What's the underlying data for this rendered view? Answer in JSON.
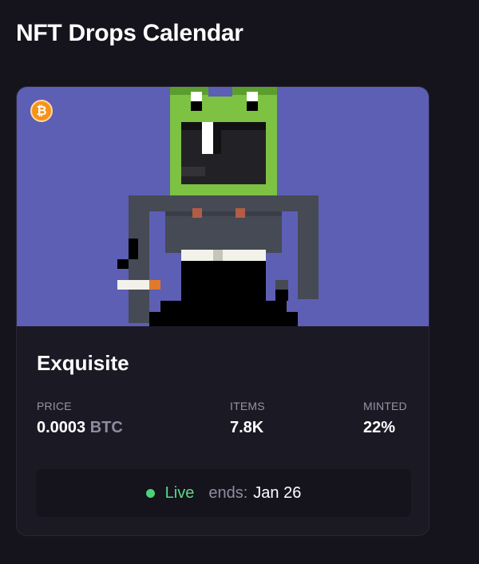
{
  "page": {
    "title": "NFT Drops Calendar"
  },
  "card": {
    "chain_icon": "bitcoin-icon",
    "chain_symbol": "₿",
    "art_background": "#5c5fb3",
    "name": "Exquisite",
    "price": {
      "label": "PRICE",
      "value": "0.0003",
      "unit": "BTC"
    },
    "items": {
      "label": "ITEMS",
      "value": "7.8K"
    },
    "minted": {
      "label": "MINTED",
      "value": "22%"
    },
    "status": {
      "label": "Live",
      "ends_label": "ends:",
      "ends_date": "Jan 26",
      "color": "#5cd887"
    }
  }
}
